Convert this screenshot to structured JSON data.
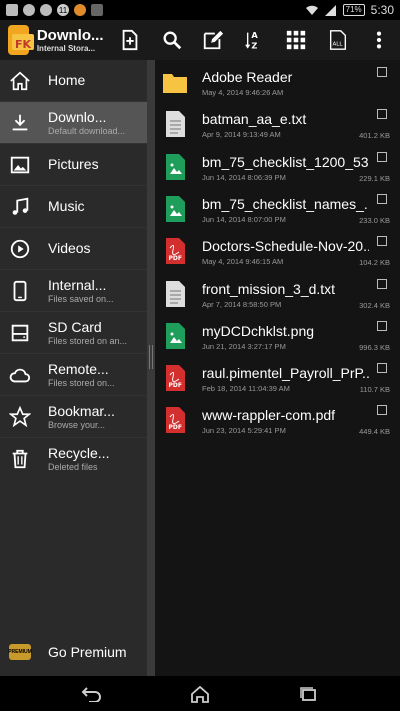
{
  "status_bar": {
    "notif_count": "11",
    "battery": "71%",
    "time": "5:30"
  },
  "header": {
    "title": "Downlo...",
    "subtitle": "Internal Stora...",
    "logo_text": "FK"
  },
  "toolbar_icons": [
    "add-file-icon",
    "search-icon",
    "edit-icon",
    "sort-az-icon",
    "grid-view-icon",
    "select-all-icon",
    "more-vert-icon"
  ],
  "sidebar": {
    "items": [
      {
        "label": "Home",
        "sub": "",
        "icon": "home-icon",
        "selected": false
      },
      {
        "label": "Downlo...",
        "sub": "Default download...",
        "icon": "download-icon",
        "selected": true
      },
      {
        "label": "Pictures",
        "sub": "",
        "icon": "pictures-icon",
        "selected": false
      },
      {
        "label": "Music",
        "sub": "",
        "icon": "music-icon",
        "selected": false
      },
      {
        "label": "Videos",
        "sub": "",
        "icon": "videos-icon",
        "selected": false
      },
      {
        "label": "Internal...",
        "sub": "Files saved on...",
        "icon": "phone-icon",
        "selected": false
      },
      {
        "label": "SD Card",
        "sub": "Files stored on an...",
        "icon": "sd-card-icon",
        "selected": false
      },
      {
        "label": "Remote...",
        "sub": "Files stored on...",
        "icon": "cloud-icon",
        "selected": false
      },
      {
        "label": "Bookmar...",
        "sub": "Browse your...",
        "icon": "star-icon",
        "selected": false
      },
      {
        "label": "Recycle...",
        "sub": "Deleted files",
        "icon": "trash-icon",
        "selected": false
      }
    ],
    "premium_label": "Go Premium",
    "premium_badge": "PREMIUM"
  },
  "files": [
    {
      "name": "Adobe Reader",
      "date": "May 4, 2014 9:46:26 AM",
      "size": "",
      "type": "folder"
    },
    {
      "name": "batman_aa_e.txt",
      "date": "Apr 9, 2014 9:13:49 AM",
      "size": "401.2 KB",
      "type": "txt"
    },
    {
      "name": "bm_75_checklist_1200_53...",
      "date": "Jun 14, 2014 8:06:39 PM",
      "size": "229.1 KB",
      "type": "img"
    },
    {
      "name": "bm_75_checklist_names_...",
      "date": "Jun 14, 2014 8:07:00 PM",
      "size": "233.0 KB",
      "type": "img"
    },
    {
      "name": "Doctors-Schedule-Nov-20...",
      "date": "May 4, 2014 9:46:15 AM",
      "size": "104.2 KB",
      "type": "pdf"
    },
    {
      "name": "front_mission_3_d.txt",
      "date": "Apr 7, 2014 8:58:50 PM",
      "size": "302.4 KB",
      "type": "txt"
    },
    {
      "name": "myDCDchklst.png",
      "date": "Jun 21, 2014 3:27:17 PM",
      "size": "996.3 KB",
      "type": "img"
    },
    {
      "name": "raul.pimentel_Payroll_PrP...",
      "date": "Feb 18, 2014 11:04:39 AM",
      "size": "110.7 KB",
      "type": "pdf"
    },
    {
      "name": "www-rappler-com.pdf",
      "date": "Jun 23, 2014 5:29:41 PM",
      "size": "449.4 KB",
      "type": "pdf"
    }
  ],
  "pdf_badge": "PDF",
  "colors": {
    "accent": "#f2a51e",
    "pdf": "#d32f2f",
    "image": "#1e9e5a",
    "folder": "#f7c342"
  }
}
